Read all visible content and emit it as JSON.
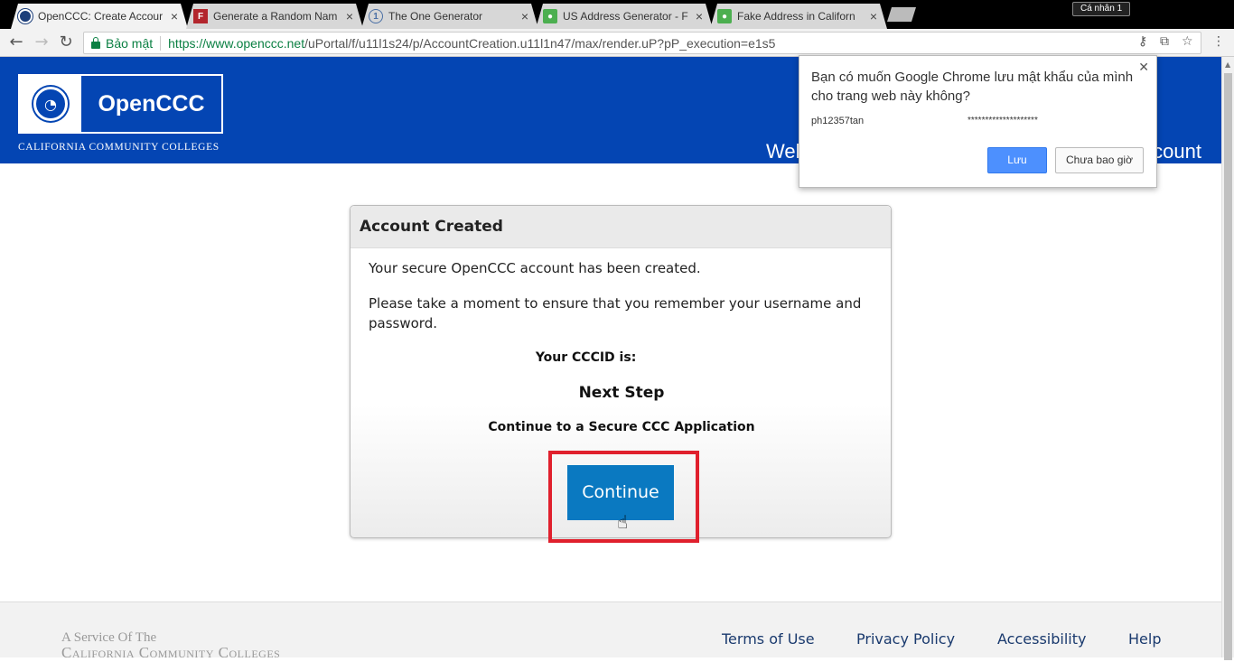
{
  "browser": {
    "tabs": [
      {
        "title": "OpenCCC: Create Accour",
        "active": true
      },
      {
        "title": "Generate a Random Nam"
      },
      {
        "title": "The One Generator"
      },
      {
        "title": "US Address Generator - F"
      },
      {
        "title": "Fake Address in Californ"
      }
    ],
    "profile_label": "Cá nhân 1",
    "secure_label": "Bảo mật",
    "url_host": "https://www.openccc.net",
    "url_path": "/uPortal/f/u11l1s24/p/AccountCreation.u11l1n47/max/render.uP?pP_execution=e1s5"
  },
  "password_bubble": {
    "message": "Bạn có muốn Google Chrome lưu mật khẩu của mình cho trang web này không?",
    "username": "ph12357tan",
    "password_mask": "********************",
    "save_label": "Lưu",
    "never_label": "Chưa bao giờ"
  },
  "header": {
    "logo_name": "OpenCCC",
    "tagline": "CALIFORNIA COMMUNITY COLLEGES",
    "welcome_start": "Wel",
    "welcome_end": "count"
  },
  "card": {
    "title": "Account Created",
    "line1": "Your secure OpenCCC account has been created.",
    "line2": "Please take a moment to ensure that you remember your username and password.",
    "cccid_label": "Your CCCID is:",
    "next_step": "Next Step",
    "continue_text": "Continue to a Secure CCC Application",
    "continue_button": "Continue"
  },
  "footer": {
    "service": "A Service Of The",
    "ccc": "California Community Colleges",
    "links": [
      "Terms of Use",
      "Privacy Policy",
      "Accessibility",
      "Help"
    ]
  },
  "colors": {
    "header_blue": "#0445b3",
    "button_blue": "#0a79c1",
    "highlight_red": "#e0202d"
  }
}
